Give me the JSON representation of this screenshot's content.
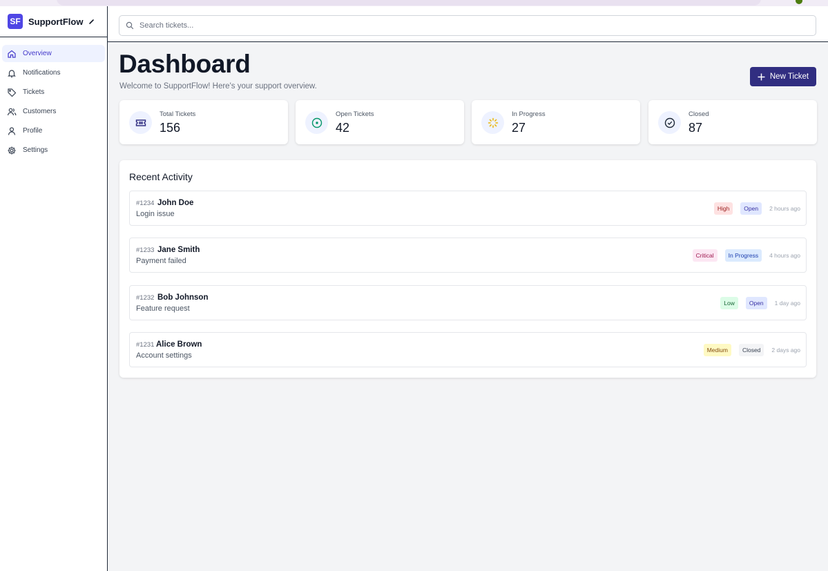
{
  "app": {
    "logo": "SF",
    "name": "SupportFlow"
  },
  "sidebar": {
    "items": [
      {
        "label": "Overview",
        "icon": "home-icon",
        "active": true
      },
      {
        "label": "Notifications",
        "icon": "bell-icon",
        "active": false
      },
      {
        "label": "Tickets",
        "icon": "tag-icon",
        "active": false
      },
      {
        "label": "Customers",
        "icon": "users-icon",
        "active": false
      },
      {
        "label": "Profile",
        "icon": "user-icon",
        "active": false
      },
      {
        "label": "Settings",
        "icon": "gear-icon",
        "active": false
      }
    ]
  },
  "search": {
    "placeholder": "Search tickets..."
  },
  "page": {
    "title": "Dashboard",
    "subtitle": "Welcome to SupportFlow! Here's your support overview.",
    "new_ticket_label": "New Ticket"
  },
  "stats": [
    {
      "label": "Total Tickets",
      "value": "156",
      "icon": "ticket-icon",
      "color": "#312e81"
    },
    {
      "label": "Open Tickets",
      "value": "42",
      "icon": "target-icon",
      "color": "#059669"
    },
    {
      "label": "In Progress",
      "value": "27",
      "icon": "loader-icon",
      "color": "#eab308"
    },
    {
      "label": "Closed",
      "value": "87",
      "icon": "check-circle-icon",
      "color": "#1f2937"
    }
  ],
  "activity": {
    "title": "Recent Activity",
    "items": [
      {
        "id": "#1234",
        "name": "John Doe",
        "desc": "Login issue",
        "priority": "High",
        "status": "Open",
        "time": "2 hours ago"
      },
      {
        "id": "#1233",
        "name": "Jane Smith",
        "desc": "Payment failed",
        "priority": "Critical",
        "status": "In Progress",
        "time": "4 hours ago"
      },
      {
        "id": "#1232",
        "name": "Bob Johnson",
        "desc": "Feature request",
        "priority": "Low",
        "status": "Open",
        "time": "1 day ago"
      },
      {
        "id": "#1231",
        "name": "Alice Brown",
        "desc": "Account settings",
        "priority": "Medium",
        "status": "Closed",
        "time": "2 days ago"
      }
    ]
  },
  "colors": {
    "accent": "#4f46e5",
    "button": "#312e81",
    "priority": {
      "High": {
        "bg": "#fee2e2",
        "fg": "#991b1b"
      },
      "Critical": {
        "bg": "#fce7f3",
        "fg": "#9d174d"
      },
      "Low": {
        "bg": "#dcfce7",
        "fg": "#166534"
      },
      "Medium": {
        "bg": "#fef9c3",
        "fg": "#854d0e"
      }
    },
    "status": {
      "Open": {
        "bg": "#e0e7ff",
        "fg": "#3730a3"
      },
      "In Progress": {
        "bg": "#dbeafe",
        "fg": "#1e40af"
      },
      "Closed": {
        "bg": "#f3f4f6",
        "fg": "#374151"
      }
    }
  }
}
